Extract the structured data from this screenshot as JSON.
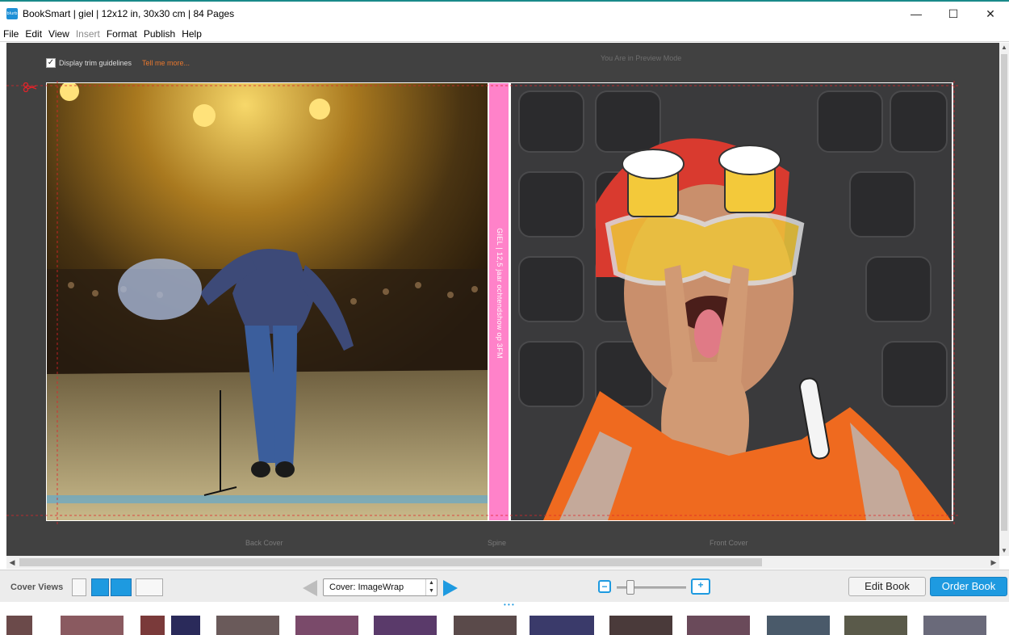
{
  "window": {
    "app_logo": "blurb",
    "title": "BookSmart  |  giel  |  12x12 in, 30x30 cm  |  84 Pages",
    "controls": {
      "minimize": "—",
      "maximize": "☐",
      "close": "✕"
    }
  },
  "menu": [
    {
      "label": "File",
      "enabled": true
    },
    {
      "label": "Edit",
      "enabled": true
    },
    {
      "label": "View",
      "enabled": true
    },
    {
      "label": "Insert",
      "enabled": false
    },
    {
      "label": "Format",
      "enabled": true
    },
    {
      "label": "Publish",
      "enabled": true
    },
    {
      "label": "Help",
      "enabled": true
    }
  ],
  "canvas": {
    "trim_checkbox_checked": true,
    "trim_label": "Display trim guidelines",
    "tell_me_more": "Tell me more...",
    "preview_mode_text": "You Are in Preview Mode",
    "spine_text": "GIEL   |   12,5 jaar ochtendshow op 3FM",
    "back_cover_label": "Back Cover",
    "spine_label": "Spine",
    "front_cover_label": "Front Cover",
    "spine_color": "#ff82c9"
  },
  "toolbar": {
    "cover_views_label": "Cover Views",
    "cover_select_value": "Cover: ImageWrap",
    "edit_book_label": "Edit Book",
    "order_book_label": "Order Book",
    "accent_color": "#1e9ae0",
    "zoom_level": 0.17
  },
  "colors": {
    "canvas_bg": "#414141",
    "link_orange": "#e8772e"
  }
}
